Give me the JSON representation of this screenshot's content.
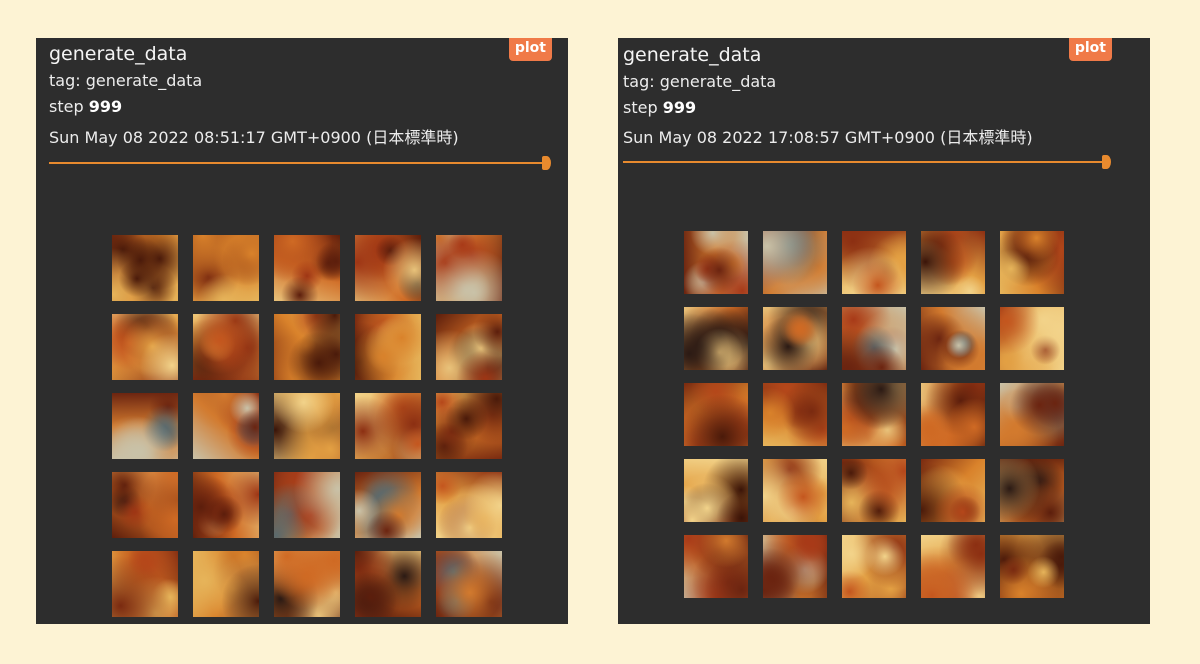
{
  "cards": [
    {
      "title": "generate_data",
      "tag_label": "tag: generate_data",
      "step_prefix": "step ",
      "step_value": "999",
      "timestamp": "Sun May 08 2022 08:51:17 GMT+0900 (日本標準時)",
      "plot_button": "plot",
      "slider_fraction": 1.0,
      "accent_color": "#e88a2e",
      "image_count": 25
    },
    {
      "title": "generate_data",
      "tag_label": "tag: generate_data",
      "step_prefix": "step ",
      "step_value": "999",
      "timestamp": "Sun May 08 2022 17:08:57 GMT+0900 (日本標準時)",
      "plot_button": "plot",
      "slider_fraction": 1.0,
      "accent_color": "#e88a2e",
      "image_count": 25
    }
  ],
  "colors": {
    "page_background": "#fdf3d4",
    "card_background": "#2d2d2d",
    "plot_button": "#f07a48"
  }
}
